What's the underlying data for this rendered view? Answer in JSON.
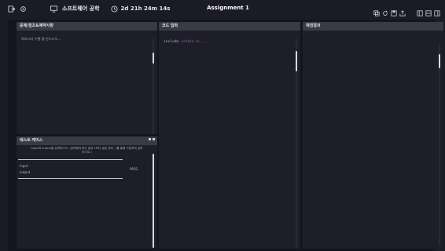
{
  "topbar": {
    "course": "소프트웨어 공학",
    "timer": "2d 21h 24m 14s",
    "title": "Assignment 1",
    "left_icons": [
      "exit-icon",
      "settings-icon"
    ],
    "course_icon": "monitor-icon",
    "timer_icon": "clock-icon",
    "right_icons": [
      "copy-icon",
      "refresh-icon",
      "save-icon",
      "upload-icon",
      "layout-icon-1",
      "layout-icon-2",
      "layout-icon-3"
    ]
  },
  "panels": {
    "problem": {
      "title": "문제/점조&제약사항",
      "content": "화보니자 수행 을 판드시오..."
    },
    "code": {
      "title": "코드 입력",
      "include_kw": "include",
      "include_hdr": "<stdio.h>..."
    },
    "result": {
      "title": "채점결과"
    },
    "testcase": {
      "title": "테스트 케이스",
      "desc_line1": "input과 output을 입력하시오. (입력해야 하는 값이 1보다 많은 경우 ','를 통해 구분하여 입력",
      "desc_line2": "하시오.)",
      "input_label": "input",
      "output_label": "output",
      "status": "PASS"
    }
  },
  "colors": {
    "background": "#1b1b26",
    "panel_header": "#3a3a46",
    "panel_body": "#1e1e29",
    "accent_include": "#8a6aa0"
  }
}
